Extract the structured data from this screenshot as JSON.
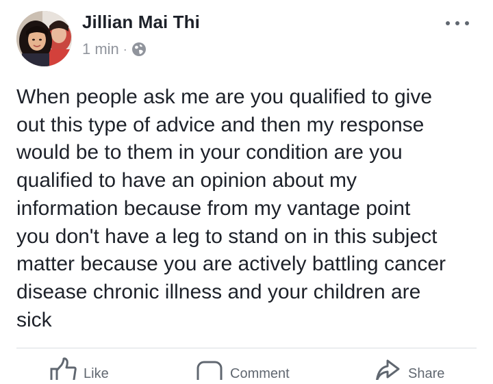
{
  "post": {
    "author": "Jillian Mai Thi",
    "time": "1 min",
    "separator": "·",
    "privacy_icon": "globe-icon",
    "text": "When people ask me are you qualified to give\nout this type of advice and then my response\nwould be to them in your condition are you\nqualified to have an opinion about my\ninformation because from my vantage point\nyou don't have a leg to stand on in this subject\nmatter because you are actively battling cancer\ndisease chronic illness and your children are\nsick"
  },
  "actions": {
    "like": "Like",
    "comment": "Comment",
    "share": "Share"
  },
  "colors": {
    "text": "#1d2129",
    "meta": "#90949c",
    "action": "#606770",
    "divider": "#dadde1"
  }
}
